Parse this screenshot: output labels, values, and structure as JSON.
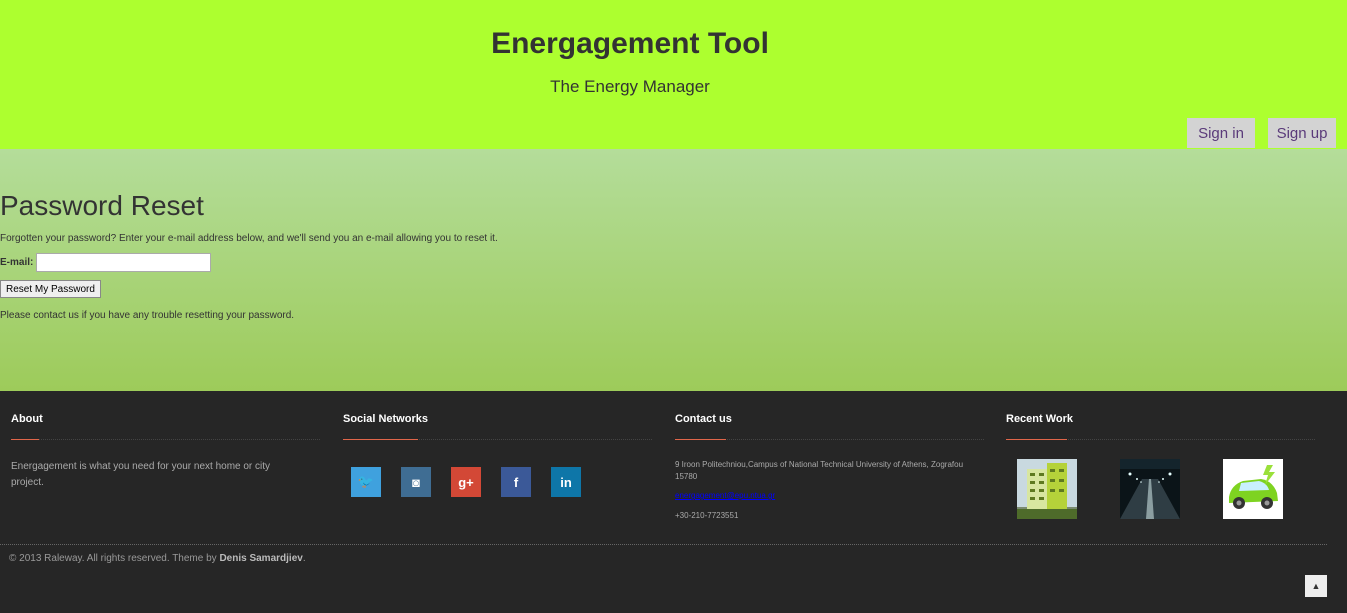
{
  "header": {
    "title": "Energagement Tool",
    "subtitle": "The Energy Manager",
    "signin_label": "Sign in",
    "signup_label": "Sign up"
  },
  "reset": {
    "title": "Password Reset",
    "intro": "Forgotten your password? Enter your e-mail address below, and we'll send you an e-mail allowing you to reset it.",
    "email_label": "E-mail:",
    "email_value": "",
    "button_label": "Reset My Password",
    "contact_text": "Please contact us if you have any trouble resetting your password."
  },
  "footer": {
    "about": {
      "heading": "About",
      "text": "Energagement is what you need for your next home or city project."
    },
    "social": {
      "heading": "Social Networks",
      "icons": [
        {
          "name": "twitter-icon",
          "glyph": "🐦",
          "color": "#3fa1de"
        },
        {
          "name": "instagram-icon",
          "glyph": "◙",
          "color": "#3f6d93"
        },
        {
          "name": "google-plus-icon",
          "glyph": "g+",
          "color": "#d34836"
        },
        {
          "name": "facebook-icon",
          "glyph": "f",
          "color": "#3b5998"
        },
        {
          "name": "linkedin-icon",
          "glyph": "in",
          "color": "#0e76a8"
        }
      ]
    },
    "contact": {
      "heading": "Contact us",
      "address": "9 Iroon Politechniou,Campus of National Technical University of Athens, Zografou 15780",
      "email": "energagement@epu.ntua.gr",
      "phone": "+30-210-7723551"
    },
    "recent": {
      "heading": "Recent Work",
      "thumbnails": [
        "green-building-thumbnail",
        "night-road-thumbnail",
        "electric-car-thumbnail"
      ]
    },
    "copyright_prefix": "© 2013 Raleway. All rights reserved. Theme by ",
    "copyright_author": "Denis Samardjiev",
    "copyright_suffix": ".",
    "to_top_icon": "arrow-up-icon"
  },
  "colors": {
    "header_bg": "#adff2f",
    "accent": "#e0664a",
    "footer_bg": "#262626"
  }
}
